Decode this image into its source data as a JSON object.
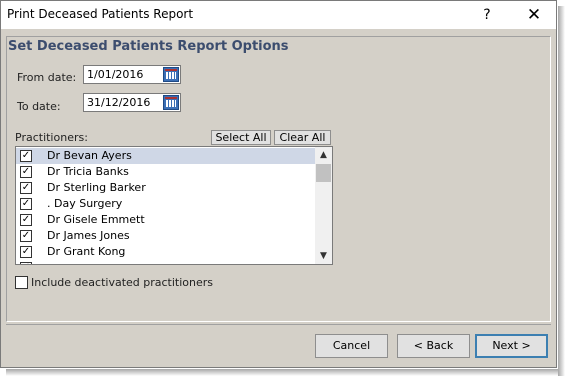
{
  "window": {
    "title": "Print Deceased Patients Report",
    "help_label": "?",
    "close_label": "✕"
  },
  "heading": "Set Deceased Patients Report Options",
  "from_date": {
    "label": "From date:",
    "value": "1/01/2016"
  },
  "to_date": {
    "label": "To date:",
    "value": "31/12/2016"
  },
  "practitioners": {
    "label": "Practitioners:",
    "select_all": "Select All",
    "clear_all": "Clear All",
    "items": [
      {
        "name": "Dr Bevan Ayers",
        "checked": true,
        "selected": true
      },
      {
        "name": "Dr Tricia Banks",
        "checked": true
      },
      {
        "name": "Dr Sterling Barker",
        "checked": true
      },
      {
        "name": ". Day Surgery",
        "checked": true
      },
      {
        "name": "Dr Gisele Emmett",
        "checked": true
      },
      {
        "name": "Dr James Jones",
        "checked": true
      },
      {
        "name": "Dr Grant Kong",
        "checked": true
      }
    ]
  },
  "include_deactivated": {
    "label": "Include deactivated practitioners",
    "checked": false
  },
  "buttons": {
    "cancel": "Cancel",
    "back": "< Back",
    "next": "Next >"
  }
}
